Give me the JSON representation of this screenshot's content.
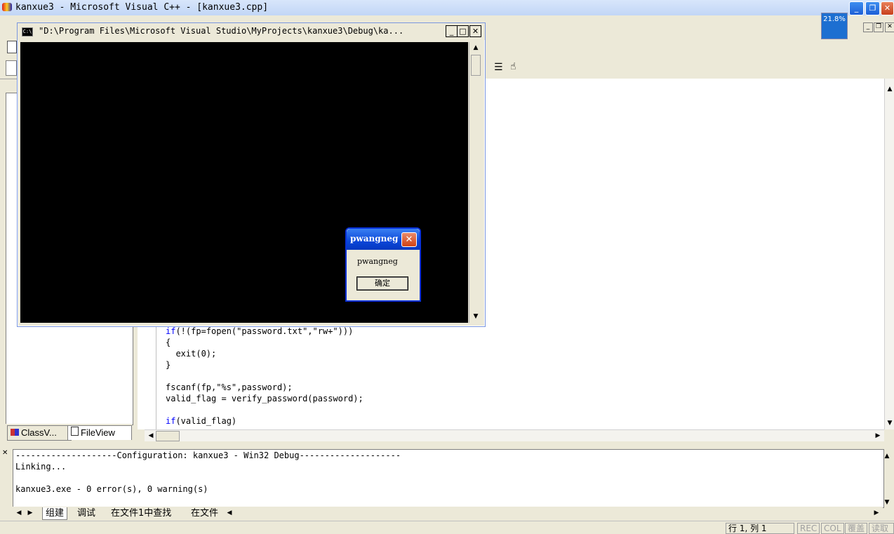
{
  "main_window": {
    "title": "kanxue3 - Microsoft Visual C++ - [kanxue3.cpp]",
    "minimize": "_",
    "restore": "❐",
    "close": "✕",
    "mdi_min": "_",
    "mdi_restore": "❐",
    "mdi_close": "✕"
  },
  "cpu_meter": "21.8%",
  "console": {
    "title": "\"D:\\Program Files\\Microsoft Visual Studio\\MyProjects\\kanxue3\\Debug\\ka...",
    "icon_text": "C:\\",
    "minimize": "_",
    "maximize": "□",
    "close": "✕"
  },
  "message_box": {
    "title": "pwangneg",
    "text": "pwangneg",
    "ok_label": "确定",
    "close": "✕"
  },
  "workspace": {
    "tabs": [
      {
        "label": "ClassV..."
      },
      {
        "label": "FileView"
      }
    ]
  },
  "editor": {
    "lines": [
      {
        "kw": "if",
        "rest": "(!(fp=fopen(\"password.txt\",\"rw+\")))"
      },
      {
        "kw": "",
        "rest": "{"
      },
      {
        "kw": "",
        "rest": "  exit(0);"
      },
      {
        "kw": "",
        "rest": "}"
      },
      {
        "kw": "",
        "rest": ""
      },
      {
        "kw": "",
        "rest": "fscanf(fp,\"%s\",password);"
      },
      {
        "kw": "",
        "rest": "valid_flag = verify_password(password);"
      },
      {
        "kw": "",
        "rest": ""
      },
      {
        "kw": "if",
        "rest": "(valid_flag)"
      }
    ]
  },
  "output": {
    "lines": [
      "--------------------Configuration: kanxue3 - Win32 Debug--------------------",
      "Linking...",
      "",
      "kanxue3.exe - 0 error(s), 0 warning(s)"
    ],
    "tabs": [
      {
        "label": "组建"
      },
      {
        "label": "调试"
      },
      {
        "label": "在文件1中查找"
      },
      {
        "label": "在文件"
      }
    ]
  },
  "status_bar": {
    "position": "行 1, 列 1",
    "rec": "REC",
    "col": "COL",
    "ovr": "覆盖",
    "read": "读取"
  }
}
